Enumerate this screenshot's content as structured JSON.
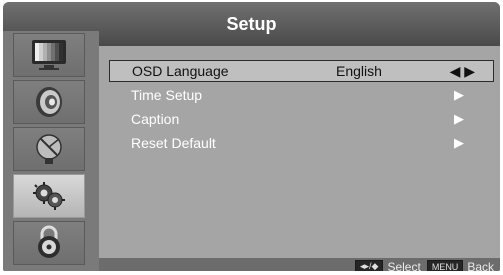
{
  "window": {
    "title": "Setup"
  },
  "sidebar": {
    "icons": [
      {
        "name": "tv-picture-icon",
        "active": false
      },
      {
        "name": "speaker-audio-icon",
        "active": false
      },
      {
        "name": "satellite-channel-icon",
        "active": false
      },
      {
        "name": "gears-setup-icon",
        "active": true
      },
      {
        "name": "lock-parental-icon",
        "active": false
      }
    ]
  },
  "menu": {
    "items": [
      {
        "label": "OSD Language",
        "value": "English",
        "arrow": "◀ ▶"
      },
      {
        "label": "Time Setup",
        "value": "",
        "arrow": "▶"
      },
      {
        "label": "Caption",
        "value": "",
        "arrow": "▶"
      },
      {
        "label": "Reset Default",
        "value": "",
        "arrow": "▶"
      }
    ]
  },
  "footer": {
    "nav_key": "◂▸/◆",
    "select_label": "Select",
    "menu_key": "MENU",
    "back_label": "Back"
  }
}
